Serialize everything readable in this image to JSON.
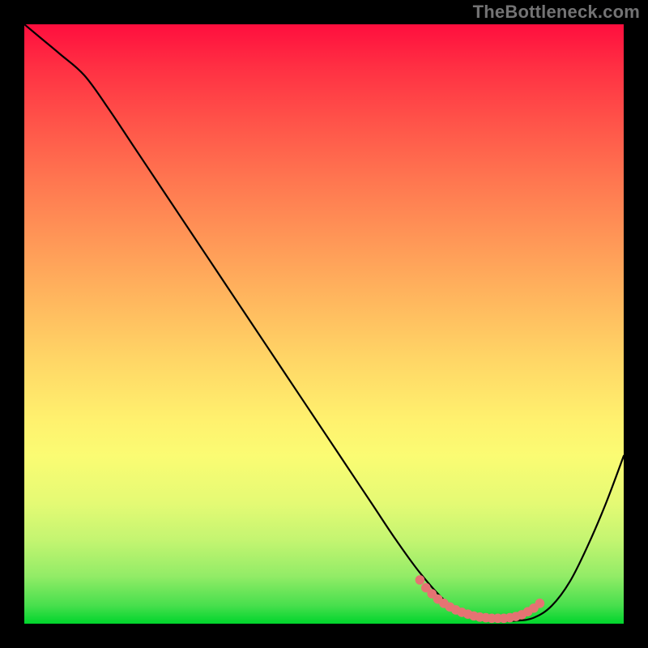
{
  "watermark": "TheBottleneck.com",
  "colors": {
    "curve_stroke": "#000000",
    "dot_fill": "#e57373",
    "gradient_top": "#ff0e3e",
    "gradient_bottom": "#00d52c"
  },
  "chart_data": {
    "type": "line",
    "title": "",
    "xlabel": "",
    "ylabel": "",
    "xlim": [
      0,
      100
    ],
    "ylim": [
      0,
      100
    ],
    "grid": false,
    "legend": false,
    "series": [
      {
        "name": "bottleneck-curve",
        "x": [
          0,
          3,
          6,
          10,
          14,
          18,
          22,
          26,
          30,
          34,
          38,
          42,
          46,
          50,
          54,
          58,
          62,
          66,
          70,
          73,
          76,
          79,
          82,
          85,
          88,
          91,
          94,
          97,
          100
        ],
        "values": [
          100,
          97.5,
          95,
          91.5,
          86,
          80,
          74,
          68,
          62,
          56,
          50,
          44,
          38,
          32,
          26,
          20,
          14,
          8.5,
          4,
          2,
          1,
          0.5,
          0.5,
          1,
          3,
          7,
          13,
          20,
          28
        ]
      }
    ],
    "valley_dots": {
      "name": "optimal-range-markers",
      "x": [
        66,
        67,
        68,
        69,
        70,
        71,
        72,
        73,
        74,
        75,
        76,
        77,
        78,
        79,
        80,
        81,
        82,
        83,
        84,
        85,
        86
      ],
      "values": [
        7.3,
        6.0,
        5.0,
        4.1,
        3.4,
        2.8,
        2.3,
        1.9,
        1.6,
        1.3,
        1.1,
        1.0,
        0.9,
        0.9,
        0.9,
        1.0,
        1.2,
        1.5,
        2.0,
        2.6,
        3.4
      ]
    }
  }
}
